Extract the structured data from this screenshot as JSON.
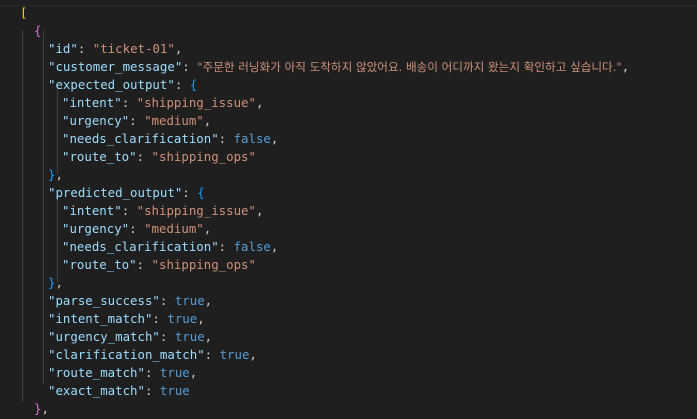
{
  "editor": {
    "language": "json",
    "colors": {
      "background": "#1f1f1f",
      "key": "#9cdcfe",
      "string": "#ce9178",
      "boolean": "#569cd6",
      "punctuation": "#cccccc",
      "bracket_level1": "#ffd700",
      "bracket_level2": "#da70d6",
      "bracket_level3": "#179fff"
    },
    "lines": [
      {
        "depth": 0,
        "tokens": [
          {
            "t": "[",
            "k": "br1"
          }
        ]
      },
      {
        "depth": 1,
        "tokens": [
          {
            "t": "{",
            "k": "br2"
          }
        ]
      },
      {
        "depth": 2,
        "tokens": [
          {
            "t": "\"id\"",
            "k": "key"
          },
          {
            "t": ": ",
            "k": "punc"
          },
          {
            "t": "\"ticket-01\"",
            "k": "str"
          },
          {
            "t": ",",
            "k": "punc"
          }
        ]
      },
      {
        "depth": 2,
        "tokens": [
          {
            "t": "\"customer_message\"",
            "k": "key"
          },
          {
            "t": ": ",
            "k": "punc"
          },
          {
            "t": "\"주문한 러닝화가 아직 도착하지 않았어요. 배송이 어디까지 왔는지 확인하고 싶습니다.\"",
            "k": "str"
          },
          {
            "t": ",",
            "k": "punc"
          }
        ]
      },
      {
        "depth": 2,
        "tokens": [
          {
            "t": "\"expected_output\"",
            "k": "key"
          },
          {
            "t": ": ",
            "k": "punc"
          },
          {
            "t": "{",
            "k": "br3"
          }
        ]
      },
      {
        "depth": 3,
        "tokens": [
          {
            "t": "\"intent\"",
            "k": "key"
          },
          {
            "t": ": ",
            "k": "punc"
          },
          {
            "t": "\"shipping_issue\"",
            "k": "str"
          },
          {
            "t": ",",
            "k": "punc"
          }
        ]
      },
      {
        "depth": 3,
        "tokens": [
          {
            "t": "\"urgency\"",
            "k": "key"
          },
          {
            "t": ": ",
            "k": "punc"
          },
          {
            "t": "\"medium\"",
            "k": "str"
          },
          {
            "t": ",",
            "k": "punc"
          }
        ]
      },
      {
        "depth": 3,
        "tokens": [
          {
            "t": "\"needs_clarification\"",
            "k": "key"
          },
          {
            "t": ": ",
            "k": "punc"
          },
          {
            "t": "false",
            "k": "bool"
          },
          {
            "t": ",",
            "k": "punc"
          }
        ]
      },
      {
        "depth": 3,
        "tokens": [
          {
            "t": "\"route_to\"",
            "k": "key"
          },
          {
            "t": ": ",
            "k": "punc"
          },
          {
            "t": "\"shipping_ops\"",
            "k": "str"
          }
        ]
      },
      {
        "depth": 2,
        "tokens": [
          {
            "t": "}",
            "k": "br3"
          },
          {
            "t": ",",
            "k": "punc"
          }
        ]
      },
      {
        "depth": 2,
        "tokens": [
          {
            "t": "\"predicted_output\"",
            "k": "key"
          },
          {
            "t": ": ",
            "k": "punc"
          },
          {
            "t": "{",
            "k": "br3"
          }
        ]
      },
      {
        "depth": 3,
        "tokens": [
          {
            "t": "\"intent\"",
            "k": "key"
          },
          {
            "t": ": ",
            "k": "punc"
          },
          {
            "t": "\"shipping_issue\"",
            "k": "str"
          },
          {
            "t": ",",
            "k": "punc"
          }
        ]
      },
      {
        "depth": 3,
        "tokens": [
          {
            "t": "\"urgency\"",
            "k": "key"
          },
          {
            "t": ": ",
            "k": "punc"
          },
          {
            "t": "\"medium\"",
            "k": "str"
          },
          {
            "t": ",",
            "k": "punc"
          }
        ]
      },
      {
        "depth": 3,
        "tokens": [
          {
            "t": "\"needs_clarification\"",
            "k": "key"
          },
          {
            "t": ": ",
            "k": "punc"
          },
          {
            "t": "false",
            "k": "bool"
          },
          {
            "t": ",",
            "k": "punc"
          }
        ]
      },
      {
        "depth": 3,
        "tokens": [
          {
            "t": "\"route_to\"",
            "k": "key"
          },
          {
            "t": ": ",
            "k": "punc"
          },
          {
            "t": "\"shipping_ops\"",
            "k": "str"
          }
        ]
      },
      {
        "depth": 2,
        "tokens": [
          {
            "t": "}",
            "k": "br3"
          },
          {
            "t": ",",
            "k": "punc"
          }
        ]
      },
      {
        "depth": 2,
        "tokens": [
          {
            "t": "\"parse_success\"",
            "k": "key"
          },
          {
            "t": ": ",
            "k": "punc"
          },
          {
            "t": "true",
            "k": "bool"
          },
          {
            "t": ",",
            "k": "punc"
          }
        ]
      },
      {
        "depth": 2,
        "tokens": [
          {
            "t": "\"intent_match\"",
            "k": "key"
          },
          {
            "t": ": ",
            "k": "punc"
          },
          {
            "t": "true",
            "k": "bool"
          },
          {
            "t": ",",
            "k": "punc"
          }
        ]
      },
      {
        "depth": 2,
        "tokens": [
          {
            "t": "\"urgency_match\"",
            "k": "key"
          },
          {
            "t": ": ",
            "k": "punc"
          },
          {
            "t": "true",
            "k": "bool"
          },
          {
            "t": ",",
            "k": "punc"
          }
        ]
      },
      {
        "depth": 2,
        "tokens": [
          {
            "t": "\"clarification_match\"",
            "k": "key"
          },
          {
            "t": ": ",
            "k": "punc"
          },
          {
            "t": "true",
            "k": "bool"
          },
          {
            "t": ",",
            "k": "punc"
          }
        ]
      },
      {
        "depth": 2,
        "tokens": [
          {
            "t": "\"route_match\"",
            "k": "key"
          },
          {
            "t": ": ",
            "k": "punc"
          },
          {
            "t": "true",
            "k": "bool"
          },
          {
            "t": ",",
            "k": "punc"
          }
        ]
      },
      {
        "depth": 2,
        "tokens": [
          {
            "t": "\"exact_match\"",
            "k": "key"
          },
          {
            "t": ": ",
            "k": "punc"
          },
          {
            "t": "true",
            "k": "bool"
          }
        ]
      },
      {
        "depth": 1,
        "tokens": [
          {
            "t": "}",
            "k": "br2"
          },
          {
            "t": ",",
            "k": "punc"
          }
        ]
      }
    ]
  }
}
